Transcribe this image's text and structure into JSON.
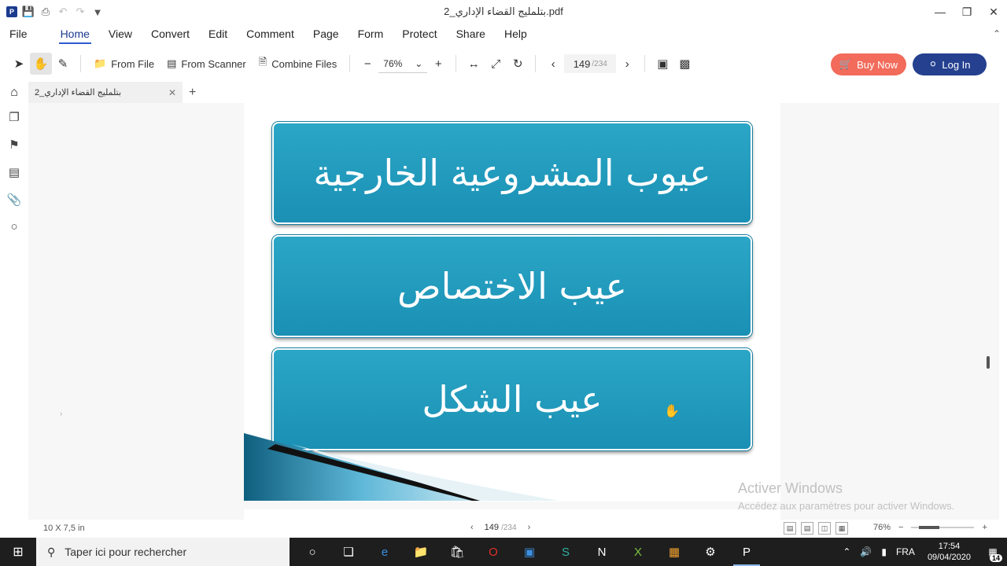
{
  "window": {
    "title": "بتلمليج القضاء الإداري_2.pdf",
    "quick_access": [
      "app-logo-icon",
      "save-icon",
      "print-icon",
      "undo-icon",
      "redo-icon",
      "customize-icon"
    ]
  },
  "menu": {
    "items": [
      "File",
      "Home",
      "View",
      "Convert",
      "Edit",
      "Comment",
      "Page",
      "Form",
      "Protect",
      "Share",
      "Help"
    ],
    "active": "Home"
  },
  "toolbar": {
    "from_file": "From File",
    "from_scanner": "From Scanner",
    "combine_files": "Combine Files",
    "zoom": "76%",
    "current_page": "149",
    "total_pages": "/234",
    "buy_now": "Buy Now",
    "log_in": "Log In"
  },
  "tabs": {
    "doc_tab": "بتلمليج القضاء الإداري_2"
  },
  "document": {
    "boxes": [
      "عيوب المشروعية الخارجية",
      "عيب الاختصاص",
      "عيب الشكل"
    ],
    "colors": {
      "box": "#1f9ac0",
      "accent_dark": "#0f5f7f"
    }
  },
  "watermark": {
    "line1": "Activer Windows",
    "line2": "Accédez aux paramètres pour activer Windows."
  },
  "statusbar": {
    "page_size": "10 X 7,5 in",
    "current_page": "149",
    "total_pages": "/234",
    "zoom": "76%"
  },
  "taskbar": {
    "search_placeholder": "Taper ici pour rechercher",
    "language": "FRA",
    "time": "17:54",
    "date": "09/04/2020",
    "notifications": "14"
  }
}
